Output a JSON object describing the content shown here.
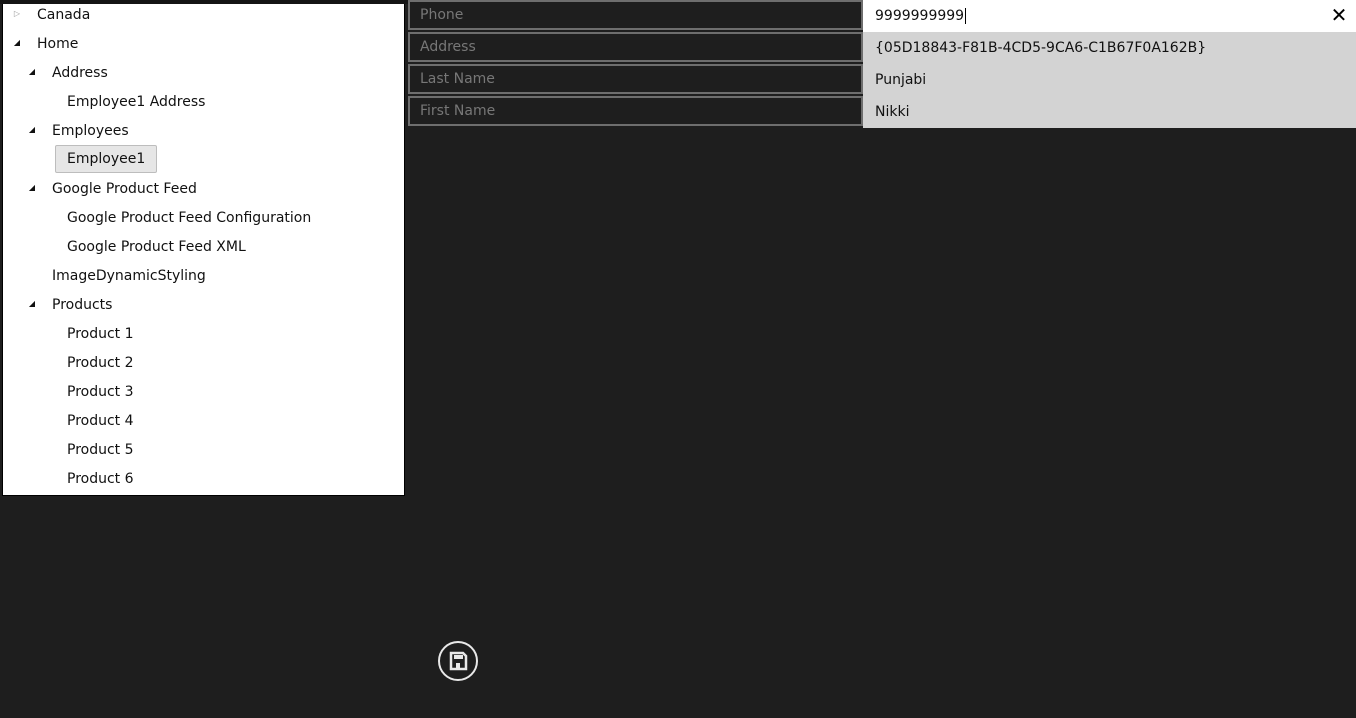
{
  "tree": {
    "nodes": [
      {
        "label": "Canada",
        "expander": "collapsed"
      },
      {
        "label": "Home",
        "expander": "expanded"
      },
      {
        "label": "Address",
        "expander": "expanded"
      },
      {
        "label": "Employee1 Address",
        "expander": "none"
      },
      {
        "label": "Employees",
        "expander": "expanded"
      },
      {
        "label": "Employee1",
        "expander": "none",
        "selected": true
      },
      {
        "label": "Google Product Feed",
        "expander": "expanded"
      },
      {
        "label": "Google Product Feed Configuration",
        "expander": "none"
      },
      {
        "label": "Google Product Feed XML",
        "expander": "none"
      },
      {
        "label": "ImageDynamicStyling",
        "expander": "none"
      },
      {
        "label": "Products",
        "expander": "expanded"
      },
      {
        "label": "Product 1",
        "expander": "none"
      },
      {
        "label": "Product 2",
        "expander": "none"
      },
      {
        "label": "Product 3",
        "expander": "none"
      },
      {
        "label": "Product 4",
        "expander": "none"
      },
      {
        "label": "Product 5",
        "expander": "none"
      },
      {
        "label": "Product 6",
        "expander": "none"
      }
    ],
    "expander_glyphs": {
      "collapsed": "▷",
      "expanded": "◢"
    }
  },
  "fields": [
    {
      "label": "Phone",
      "value": "9999999999",
      "active": true,
      "clear_icon": "✕"
    },
    {
      "label": "Address",
      "value": "{05D18843-F81B-4CD5-9CA6-C1B67F0A162B}"
    },
    {
      "label": "Last Name",
      "value": "Punjabi"
    },
    {
      "label": "First Name",
      "value": "Nikki"
    }
  ],
  "save_button": {
    "icon": "save-icon"
  }
}
